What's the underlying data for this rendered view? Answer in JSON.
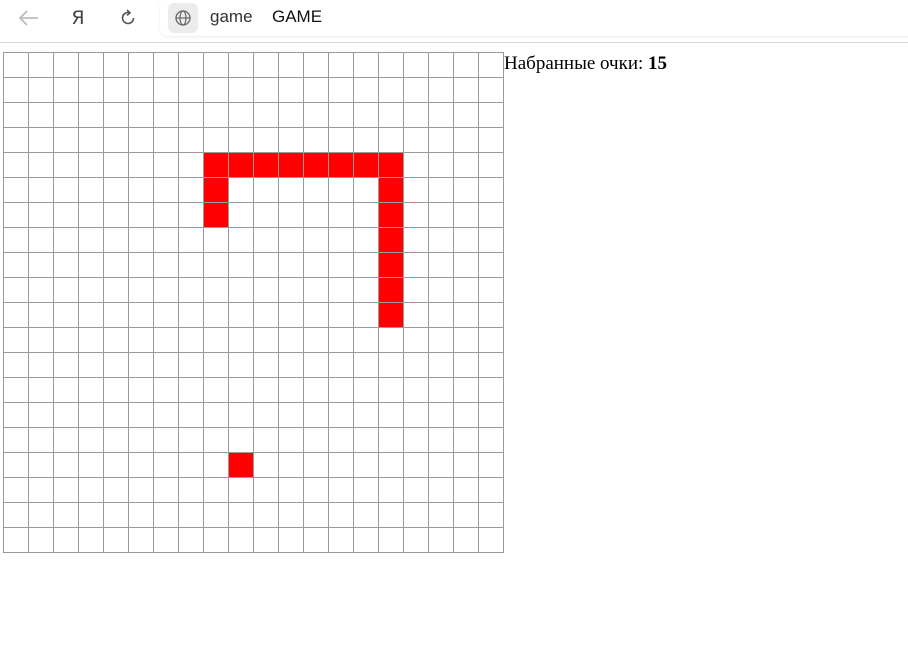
{
  "browser": {
    "address_host": "game",
    "tab_title": "GAME",
    "yandex_label": "Я",
    "icons": [
      "back-arrow-icon",
      "yandex-icon",
      "reload-icon",
      "globe-icon"
    ]
  },
  "game": {
    "score_label": "Набранные очки:",
    "score_value": "15",
    "grid": {
      "cols": 20,
      "rows": 20
    },
    "snake_cells": [
      [
        8,
        4
      ],
      [
        9,
        4
      ],
      [
        10,
        4
      ],
      [
        11,
        4
      ],
      [
        12,
        4
      ],
      [
        13,
        4
      ],
      [
        14,
        4
      ],
      [
        15,
        4
      ],
      [
        8,
        5
      ],
      [
        8,
        6
      ],
      [
        15,
        5
      ],
      [
        15,
        6
      ],
      [
        15,
        7
      ],
      [
        15,
        8
      ],
      [
        15,
        9
      ],
      [
        15,
        10
      ]
    ],
    "food_cell": [
      9,
      16
    ],
    "colors": {
      "snake": "#ff0000",
      "food": "#ff0000",
      "grid_line": "#9a9a9a",
      "background": "#ffffff"
    }
  }
}
